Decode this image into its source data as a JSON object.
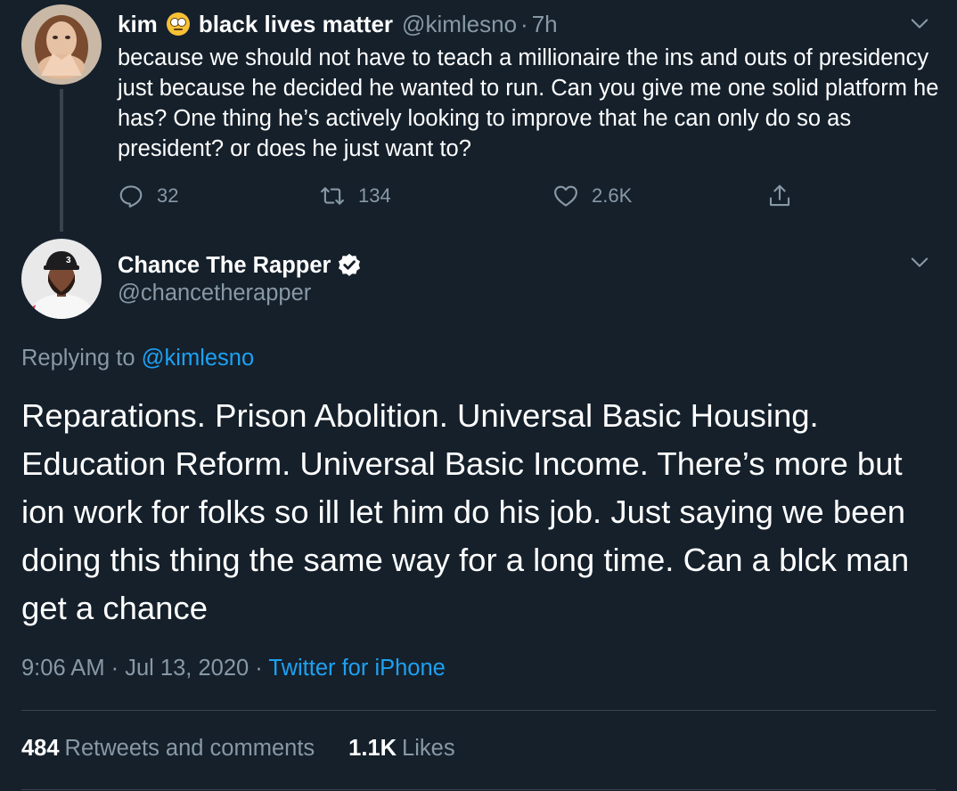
{
  "parent_tweet": {
    "display_name": "kim",
    "name_emoji": "face-with-rolling-eyes-emoji",
    "name_suffix": "black lives matter",
    "handle": "@kimlesno",
    "separator": "·",
    "time_ago": "7h",
    "text": "because we should not have to teach a millionaire the ins and outs of presidency just because he decided he wanted to run. Can you give me one solid platform he has? One thing he’s actively looking to improve that he can only do so as president? or does he just want to?",
    "reply_count": "32",
    "retweet_count": "134",
    "like_count": "2.6K",
    "icons": {
      "reply": "reply-icon",
      "retweet": "retweet-icon",
      "like": "heart-icon",
      "share": "share-icon",
      "menu": "chevron-down-icon"
    }
  },
  "main_tweet": {
    "display_name": "Chance The Rapper",
    "handle": "@chancetherapper",
    "verified": true,
    "replying_prefix": "Replying to",
    "replying_to": "@kimlesno",
    "text": "Reparations. Prison Abolition. Universal Basic Housing. Education Reform. Universal Basic Income. There’s more but ion work for folks so ill let him do his job. Just saying we been doing this thing the same way for a long time. Can a blck man get a chance",
    "time": "9:06 AM",
    "separator": "·",
    "date": "Jul 13, 2020",
    "source": "Twitter for iPhone",
    "retweets_and_comments_count": "484",
    "retweets_and_comments_label": "Retweets and comments",
    "likes_count": "1.1K",
    "likes_label": "Likes"
  },
  "colors": {
    "background": "#15202b",
    "text": "#ffffff",
    "muted": "#8899a6",
    "link": "#1da1f2",
    "divider": "#38444d"
  }
}
